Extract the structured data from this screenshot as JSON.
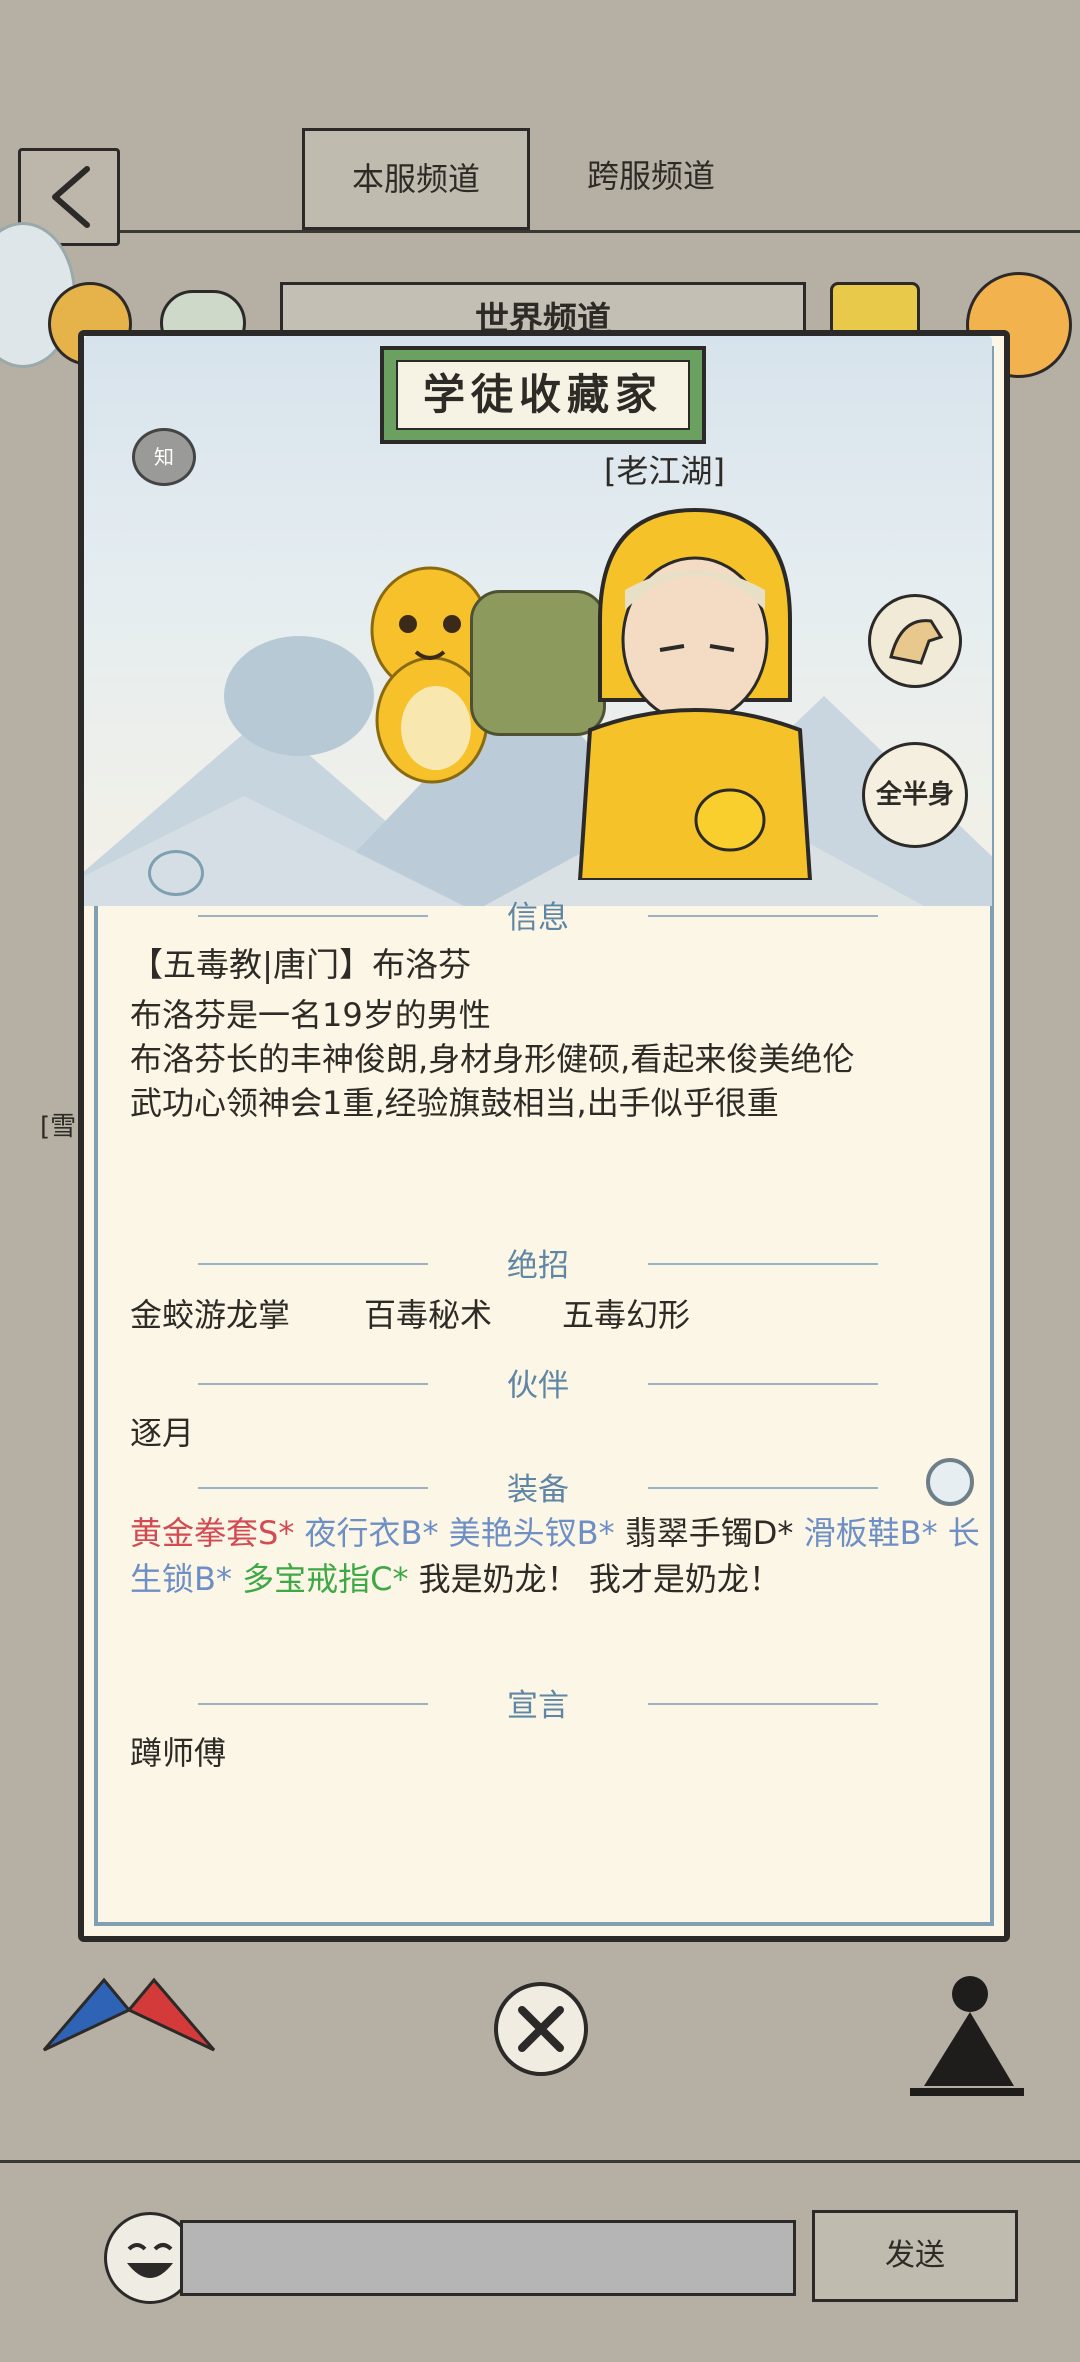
{
  "tabs": {
    "server": "本服频道",
    "cross": "跨服频道"
  },
  "world_channel": "世界频道",
  "card": {
    "title": "学徒收藏家",
    "badge": "知",
    "rank": "[老江湖]",
    "side_buttons": {
      "full_half": "全半身"
    },
    "sections": {
      "info": "信息",
      "skills": "绝招",
      "partner": "伙伴",
      "equipment": "装备",
      "manifesto": "宣言"
    },
    "info_lines": [
      "【五毒教|唐门】布洛芬",
      "布洛芬是一名19岁的男性",
      "布洛芬长的丰神俊朗,身材身形健硕,看起来俊美绝伦",
      "武功心领神会1重,经验旗鼓相当,出手似乎很重"
    ],
    "skills": [
      "金蛟游龙掌",
      "百毒秘术",
      "五毒幻形"
    ],
    "partner": "逐月",
    "equipment": [
      {
        "name": "黄金拳套S*",
        "color": "gold"
      },
      {
        "name": "夜行衣B*",
        "color": "blue"
      },
      {
        "name": "美艳头钗B*",
        "color": "blue"
      },
      {
        "name": "翡翠手镯D*",
        "color": "plain"
      },
      {
        "name": "滑板鞋B*",
        "color": "blue"
      },
      {
        "name": "长生锁B*",
        "color": "blue"
      },
      {
        "name": "多宝戒指C*",
        "color": "green"
      },
      {
        "name": "我是奶龙！",
        "color": "plain"
      },
      {
        "name": "我才是奶龙！",
        "color": "plain"
      }
    ],
    "manifesto": "蹲师傅"
  },
  "side_peek": "[雪",
  "send_label": "发送",
  "colors": {
    "gold": "#d24b52",
    "blue": "#6d8fc5",
    "green": "#3ea845",
    "section": "#5f86a4",
    "title_plate": "#6aa161"
  }
}
